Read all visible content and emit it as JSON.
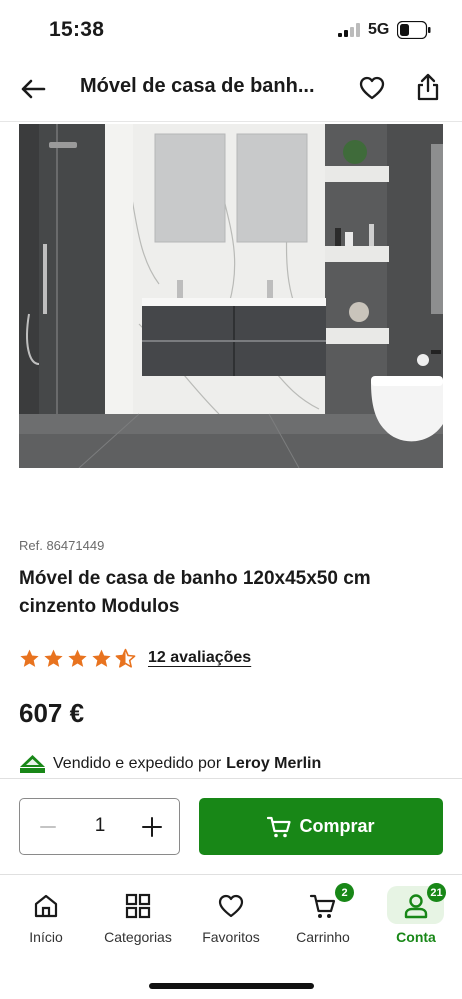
{
  "status_bar": {
    "time": "15:38",
    "network": "5G"
  },
  "nav": {
    "title": "Móvel de casa de banho 120x45x50 cm cinzento Modulos",
    "title_display": "Móvel de casa de banh..."
  },
  "icons": {
    "back": "arrow-left-icon",
    "favorite": "heart-icon",
    "share": "share-icon",
    "star": "star-icon",
    "cart": "cart-icon"
  },
  "product": {
    "ref": "Ref. 86471449",
    "title": "Móvel de casa de banho 120x45x50 cm cinzento Modulos",
    "rating": 4.5,
    "rating_max": 5,
    "reviews_label": "12 avaliações",
    "price": "607 €",
    "seller_prefix": "Vendido e expedido por",
    "seller_name": "Leroy Merlin"
  },
  "purchase": {
    "quantity": "1",
    "buy_label": "Comprar"
  },
  "tab_bar": {
    "tabs": [
      {
        "label": "Início",
        "icon": "home-icon",
        "badge": ""
      },
      {
        "label": "Categorias",
        "icon": "grid-icon",
        "badge": ""
      },
      {
        "label": "Favoritos",
        "icon": "heart-icon",
        "badge": ""
      },
      {
        "label": "Carrinho",
        "icon": "cart-icon",
        "badge": "2"
      },
      {
        "label": "Conta",
        "icon": "user-icon",
        "badge": "21"
      }
    ],
    "active": "Conta"
  },
  "colors": {
    "brand_green": "#188717",
    "star_orange": "#e8731f",
    "active_tab_bg": "#e7f4e4",
    "text": "#1a1a1a",
    "muted": "#6b6b6b"
  }
}
